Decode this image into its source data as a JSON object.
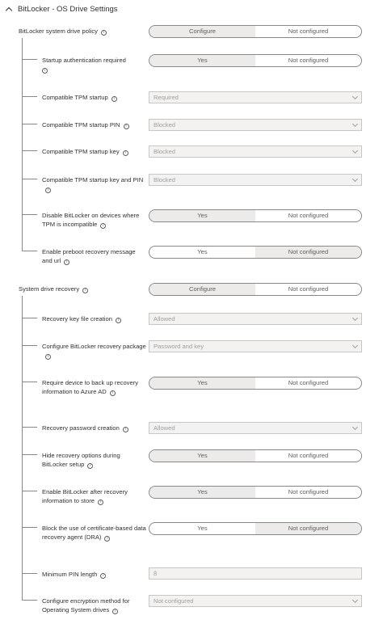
{
  "header": {
    "title": "BitLocker - OS Drive Settings"
  },
  "settings": [
    {
      "label": "BitLocker system drive policy",
      "control": "toggle",
      "left": "Configure",
      "right": "Not configured",
      "selected": "left"
    },
    {
      "label": "Startup authentication required",
      "control": "toggle",
      "left": "Yes",
      "right": "Not configured",
      "selected": "left"
    },
    {
      "label": "Compatible TPM startup",
      "control": "select",
      "value": "Required"
    },
    {
      "label": "Compatible TPM startup PIN",
      "control": "select",
      "value": "Blocked"
    },
    {
      "label": "Compatible TPM startup key",
      "control": "select",
      "value": "Blocked"
    },
    {
      "label": "Compatible TPM startup key and PIN",
      "control": "select",
      "value": "Blocked"
    },
    {
      "label": "Disable BitLocker on devices where TPM is incompatible",
      "control": "toggle",
      "left": "Yes",
      "right": "Not configured",
      "selected": "left"
    },
    {
      "label": "Enable preboot recovery message and url",
      "control": "toggle",
      "left": "Yes",
      "right": "Not configured",
      "selected": "right"
    },
    {
      "label": "System drive recovery",
      "control": "toggle",
      "left": "Configure",
      "right": "Not configured",
      "selected": "left"
    },
    {
      "label": "Recovery key file creation",
      "control": "select",
      "value": "Allowed"
    },
    {
      "label": "Configure BitLocker recovery package",
      "control": "select",
      "value": "Password and key"
    },
    {
      "label": "Require device to back up recovery information to Azure AD",
      "control": "toggle",
      "left": "Yes",
      "right": "Not configured",
      "selected": "left"
    },
    {
      "label": "Recovery password creation",
      "control": "select",
      "value": "Allowed"
    },
    {
      "label": "Hide recovery options during BitLocker setup",
      "control": "toggle",
      "left": "Yes",
      "right": "Not configured",
      "selected": "left"
    },
    {
      "label": "Enable BitLocker after recovery information to store",
      "control": "toggle",
      "left": "Yes",
      "right": "Not configured",
      "selected": "left"
    },
    {
      "label": "Block the use of certificate-based data recovery agent (DRA)",
      "control": "toggle",
      "left": "Yes",
      "right": "Not configured",
      "selected": "right"
    },
    {
      "label": "Minimum PIN length",
      "control": "text",
      "value": "8"
    },
    {
      "label": "Configure encryption method for Operating System drives",
      "control": "select",
      "value": "Not configured"
    }
  ],
  "icons": {
    "expander": "chevron-up-icon",
    "info": "info-icon",
    "dropdown": "chevron-down-icon"
  }
}
